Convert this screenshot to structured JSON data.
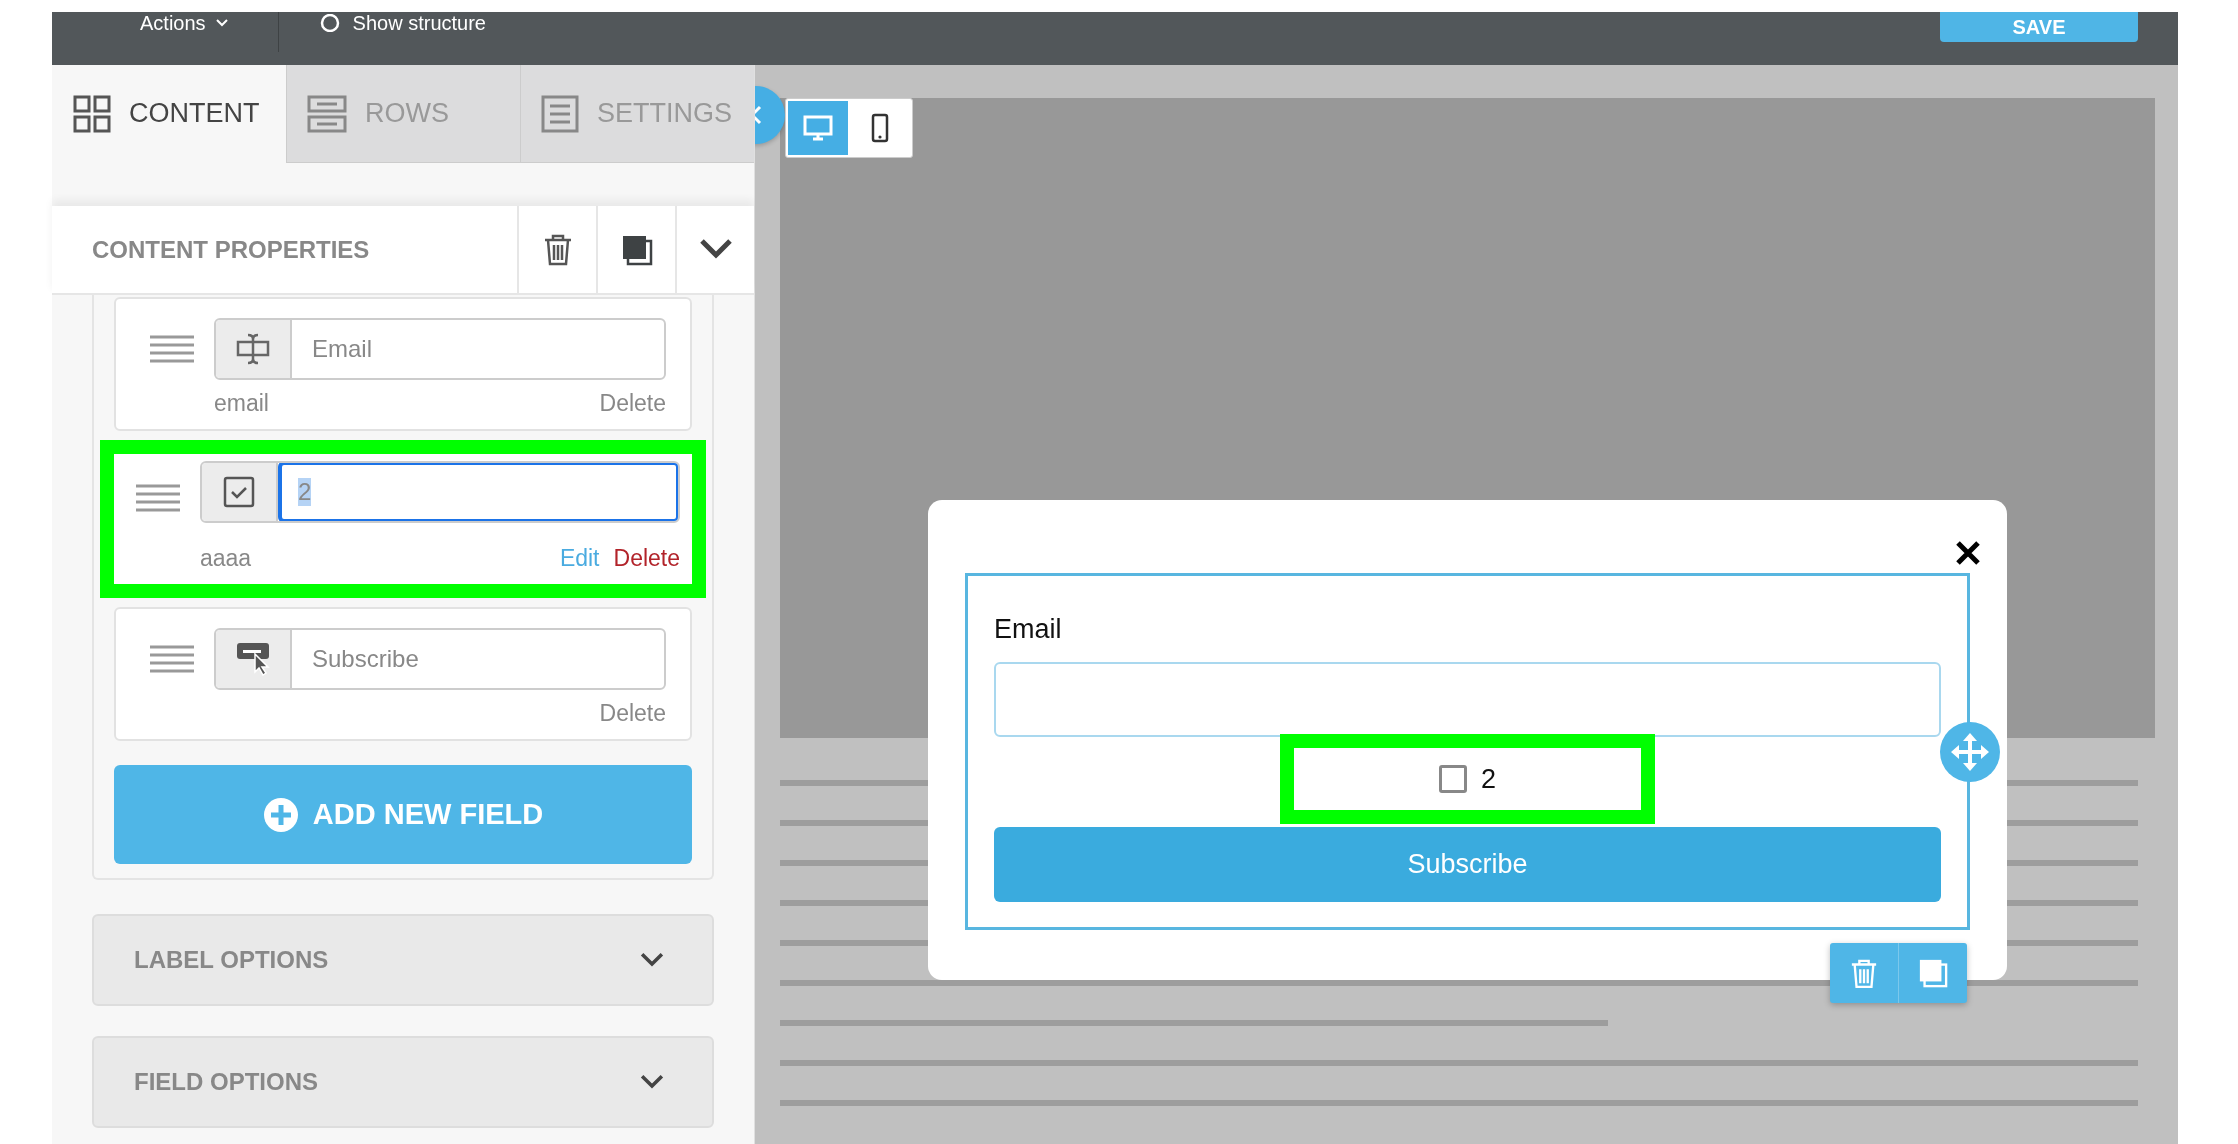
{
  "toolbar": {
    "actions": "Actions",
    "show_structure": "Show structure",
    "save": "SAVE"
  },
  "tabs": [
    {
      "label": "CONTENT",
      "kind": "content",
      "selected": true
    },
    {
      "label": "ROWS",
      "kind": "rows",
      "selected": false
    },
    {
      "label": "SETTINGS",
      "kind": "settings",
      "selected": false
    }
  ],
  "device_toggle": [
    {
      "kind": "desktop",
      "selected": true
    },
    {
      "kind": "mobile",
      "selected": false
    }
  ],
  "content_properties": {
    "title": "CONTENT PROPERTIES"
  },
  "fields": [
    {
      "kind": "text",
      "value": "Email",
      "name": "email",
      "delete": "Delete",
      "focused": false,
      "highlighted": false
    },
    {
      "kind": "checkbox",
      "value": "2",
      "name": "aaaa",
      "edit": "Edit",
      "delete": "Delete",
      "focused": true,
      "highlighted": true
    },
    {
      "kind": "button",
      "value": "Subscribe",
      "delete": "Delete",
      "focused": false,
      "highlighted": false
    }
  ],
  "add_field": "ADD NEW FIELD",
  "sections": [
    {
      "title": "LABEL OPTIONS",
      "expanded": false
    },
    {
      "title": "FIELD OPTIONS",
      "expanded": false
    }
  ],
  "preview": {
    "email_label": "Email",
    "checkbox": {
      "label": "2",
      "checked": false,
      "highlighted": true
    },
    "submit": "Subscribe"
  }
}
